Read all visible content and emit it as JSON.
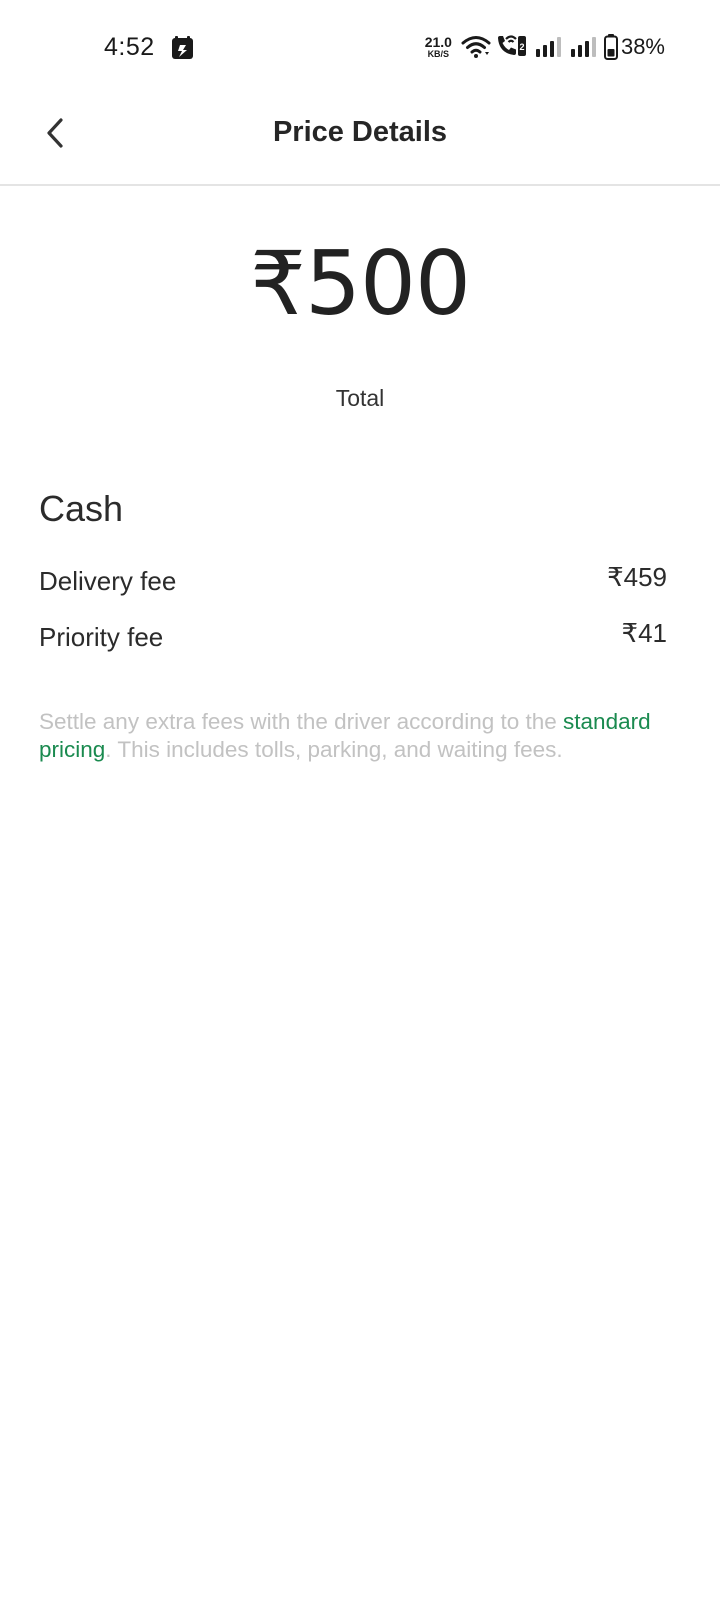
{
  "status_bar": {
    "time": "4:52",
    "net_speed_value": "21.0",
    "net_speed_unit": "KB/S",
    "battery_percent": "38%",
    "icons": [
      "notification-app-icon",
      "wifi-icon",
      "wifi-calling-icon",
      "signal-sim1-icon",
      "signal-sim2-icon",
      "battery-icon"
    ]
  },
  "header": {
    "title": "Price Details",
    "back_icon": "chevron-left-icon"
  },
  "total": {
    "amount": "₹500",
    "label": "Total"
  },
  "breakdown": {
    "payment_method": "Cash",
    "rows": [
      {
        "label": "Delivery fee",
        "value": "₹459"
      },
      {
        "label": "Priority fee",
        "value": "₹41"
      }
    ]
  },
  "note": {
    "before_link": "Settle any extra fees with the driver according to the",
    "link_text": "standard pricing",
    "after_link": ". This includes tolls, parking, and waiting fees."
  },
  "colors": {
    "link": "#1a8a4f",
    "note_text": "#c2c2c2",
    "primary_text": "#262626",
    "divider": "#e4e4e4"
  }
}
